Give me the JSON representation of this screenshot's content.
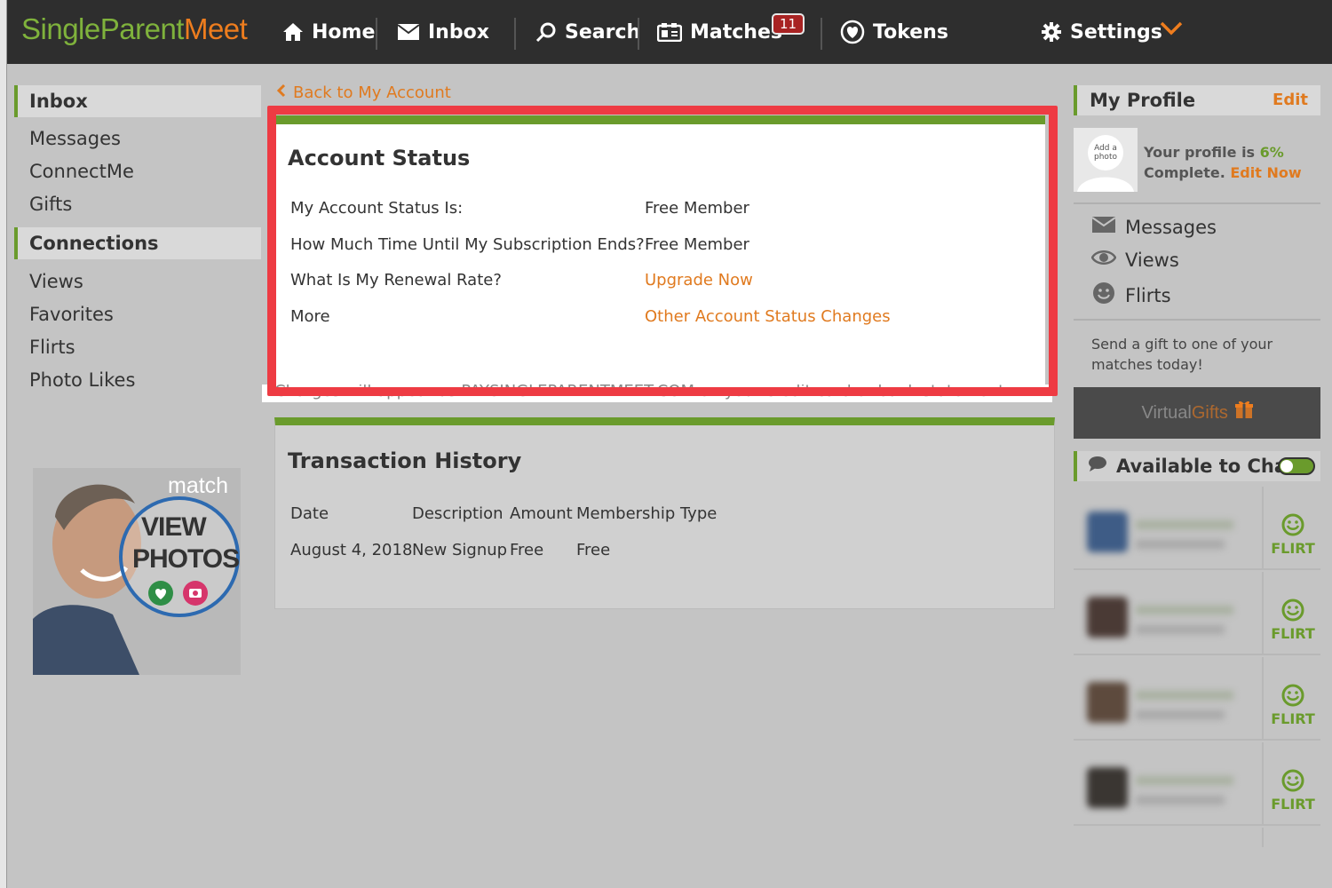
{
  "brand": {
    "part1": "SingleParent",
    "part2": "Meet"
  },
  "nav": {
    "home": "Home",
    "inbox": "Inbox",
    "search": "Search",
    "matches": "Matches",
    "matches_count": "11",
    "tokens": "Tokens",
    "settings": "Settings"
  },
  "left_sidebar": {
    "inbox_header": "Inbox",
    "inbox_items": [
      "Messages",
      "ConnectMe",
      "Gifts"
    ],
    "connections_header": "Connections",
    "connections_items": [
      "Views",
      "Favorites",
      "Flirts",
      "Photo Likes"
    ],
    "ad": {
      "brand": "match",
      "line1": "VIEW",
      "line2": "PHOTOS"
    }
  },
  "main": {
    "back_link": "Back to My Account",
    "account_status": {
      "title": "Account Status",
      "rows": [
        {
          "label": "My Account Status Is:",
          "value": "Free Member"
        },
        {
          "label": "How Much Time Until My Subscription Ends?",
          "value": "Free Member"
        },
        {
          "label": "What Is My Renewal Rate?",
          "value": "Upgrade Now"
        },
        {
          "label": "More",
          "value": "Other Account Status Changes"
        }
      ],
      "note": "Charges will appear as PAYSINGLEPARENTMEET.COM on your credit card or bank statement."
    },
    "transactions": {
      "title": "Transaction History",
      "columns": [
        "Date",
        "Description",
        "Amount",
        "Membership Type"
      ],
      "rows": [
        {
          "date": "August 4, 2018",
          "description": "New Signup",
          "amount": "Free",
          "type": "Free"
        }
      ]
    }
  },
  "right_sidebar": {
    "profile_header": "My Profile",
    "edit": "Edit",
    "avatar_text": "Add a photo",
    "profile_text_1": "Your profile is",
    "profile_pct": "6%",
    "profile_text_2": "Complete.",
    "edit_now": "Edit Now",
    "links": [
      "Messages",
      "Views",
      "Flirts"
    ],
    "gift_text": "Send a gift to one of your matches today!",
    "virtual_gifts": {
      "part1": "Virtual",
      "part2": "Gifts"
    },
    "chat_header": "Available to Chat",
    "flirt_label": "FLIRT"
  },
  "colors": {
    "accent_green": "#6a9b2c",
    "accent_orange": "#e07a1f",
    "highlight_red": "#ee3b43",
    "nav_bg": "#2e2e2e"
  }
}
